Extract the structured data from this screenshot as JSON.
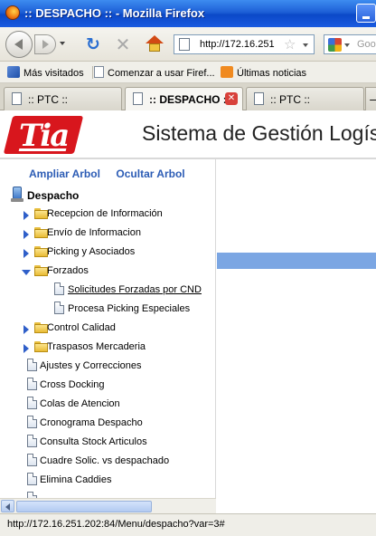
{
  "window": {
    "title": ":: DESPACHO :: - Mozilla Firefox"
  },
  "navbar": {
    "url": "http://172.16.251",
    "search_placeholder": "Goo"
  },
  "bookmarks": [
    {
      "label": "Más visitados",
      "icon": "most-visited-icon"
    },
    {
      "label": "Comenzar a usar Firef...",
      "icon": "page-icon"
    },
    {
      "label": "Últimas noticias",
      "icon": "rss-icon"
    }
  ],
  "tabs": [
    {
      "label": ":: PTC ::",
      "active": false
    },
    {
      "label": ":: DESPACHO ::",
      "active": true
    },
    {
      "label": ":: PTC ::",
      "active": false
    }
  ],
  "header": {
    "logo_text": "Tia",
    "system_title": "Sistema de Gestión Logísti"
  },
  "tree": {
    "expand_link": "Ampliar Arbol",
    "hide_link": "Ocultar Arbol",
    "root_label": "Despacho",
    "folders_top": [
      "Recepcion de Información",
      "Envío de Informacion",
      "Picking y Asociados",
      "Forzados"
    ],
    "forzados_children": [
      "Solicitudes Forzadas por CND",
      "Procesa Picking Especiales"
    ],
    "folders_bottom": [
      "Control Calidad",
      "Traspasos Mercaderia"
    ],
    "documents": [
      "Ajustes y Correcciones",
      "Cross Docking",
      "Colas de Atencion",
      "Cronograma Despacho",
      "Consulta Stock Articulos",
      "Cuadre Solic. vs despachado",
      "Elimina Caddies"
    ]
  },
  "status": {
    "text": "http://172.16.251.202:84/Menu/despacho?var=3#"
  },
  "colors": {
    "titlebar": "#1d5fd6",
    "logo_red": "#d8161d",
    "link_blue": "#2c5cb5",
    "content_highlight": "#7ba6e3"
  }
}
